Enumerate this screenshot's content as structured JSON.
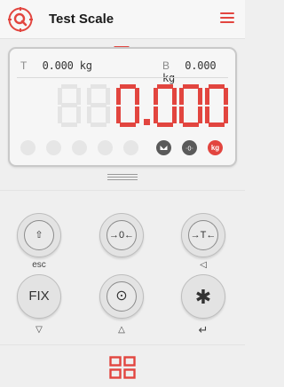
{
  "header": {
    "title": "Test Scale"
  },
  "display": {
    "tare_label": "T",
    "tare_value": "0.000 kg",
    "gross_label": "B",
    "gross_value": "0.000 kg",
    "ghost_digits": "88",
    "main_value": "0.000",
    "unit_badge": "kg"
  },
  "indicators": [
    {
      "name": "indicator-1",
      "active": false
    },
    {
      "name": "indicator-2",
      "active": false
    },
    {
      "name": "indicator-3",
      "active": false
    },
    {
      "name": "indicator-4",
      "active": false
    },
    {
      "name": "indicator-5",
      "active": false
    },
    {
      "name": "stable-indicator",
      "active": true
    },
    {
      "name": "zero-indicator",
      "active": true
    },
    {
      "name": "kg-indicator",
      "active": true
    }
  ],
  "keypad": {
    "shift": {
      "label": "⇧",
      "sub": "esc"
    },
    "zero": {
      "label": "→0←",
      "sub": ""
    },
    "tare": {
      "label": "→T←",
      "sub": "◁"
    },
    "fix": {
      "label": "FIX",
      "sub": "▽"
    },
    "target": {
      "label": "⊙",
      "sub": "△"
    },
    "star": {
      "label": "✱",
      "sub": "↵"
    }
  },
  "colors": {
    "accent": "#e2453f",
    "background": "#efefef",
    "panel": "#f6f6f6"
  }
}
